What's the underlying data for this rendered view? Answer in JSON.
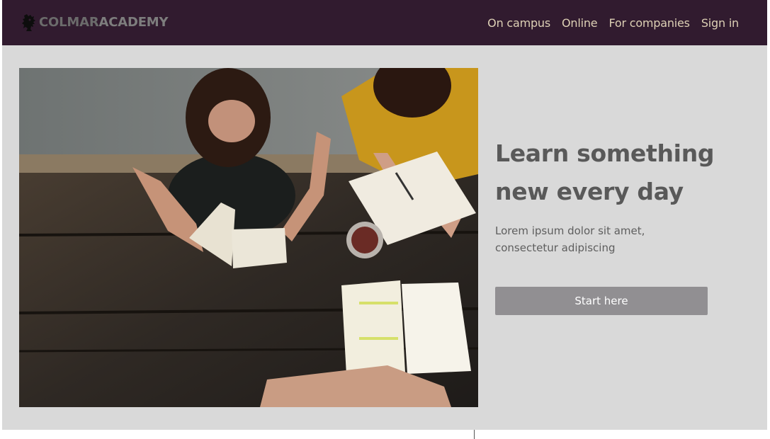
{
  "brand": {
    "name_part1": "COLMAR",
    "name_part2": "ACADEMY",
    "logo_icon": "lion-crest-icon"
  },
  "nav": {
    "items": [
      {
        "label": "On campus"
      },
      {
        "label": "Online"
      },
      {
        "label": "For companies"
      },
      {
        "label": "Sign in"
      }
    ]
  },
  "hero": {
    "image_subject": "students-reading-at-wooden-table",
    "title_line1": "Learn something",
    "title_line2": "new every day",
    "subtitle": "Lorem ipsum dolor sit amet, consectetur adipiscing",
    "cta_label": "Start here"
  },
  "colors": {
    "navbar_bg": "#311b2f",
    "nav_link": "#ddd0b5",
    "page_bg": "#d9d9d9",
    "title_text": "#595959",
    "cta_bg": "#918f92",
    "cta_text": "#ffffff"
  }
}
